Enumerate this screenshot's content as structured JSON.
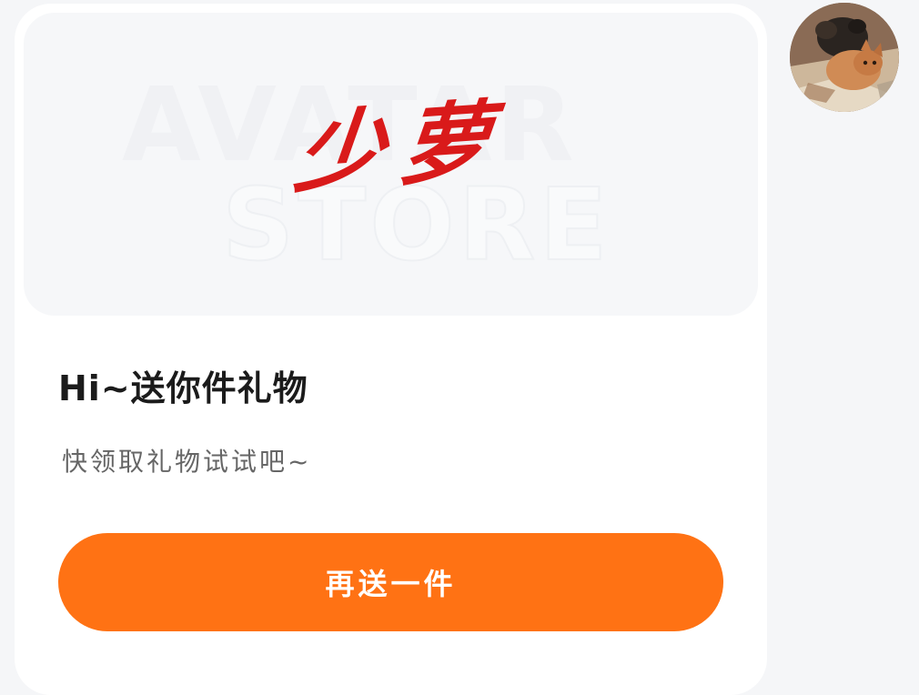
{
  "banner": {
    "watermark_line1": "AVATAR",
    "watermark_line2": "STORE",
    "calligraphy_text": "少萝"
  },
  "message": {
    "headline": "Hi~送你件礼物",
    "subline": "快领取礼物试试吧~"
  },
  "actions": {
    "send_again_label": "再送一件"
  },
  "avatar": {
    "icon": "cat-photo-avatar"
  },
  "colors": {
    "accent": "#ff7214",
    "calligraphy": "#d91a1a"
  }
}
